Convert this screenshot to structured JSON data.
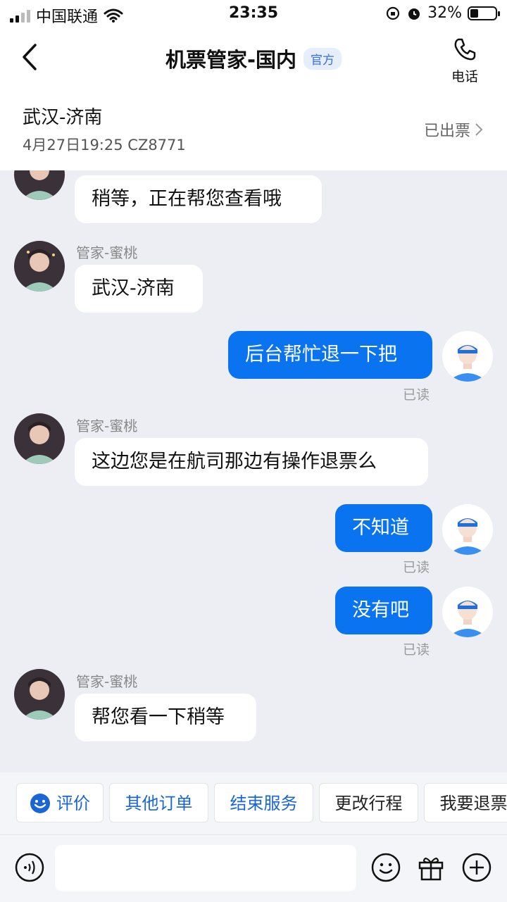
{
  "status_bar": {
    "carrier": "中国联通",
    "time": "23:35",
    "battery": "32%"
  },
  "header": {
    "title": "机票管家-国内",
    "badge": "官方",
    "phone_label": "电话"
  },
  "flight": {
    "route": "武汉-济南",
    "detail": "4月27日19:25 CZ8771",
    "status": "已出票"
  },
  "messages": [
    {
      "side": "in",
      "sender": "",
      "text": "稍等，正在帮您查看哦"
    },
    {
      "side": "in",
      "sender": "管家-蜜桃",
      "text": "武汉-济南"
    },
    {
      "side": "out",
      "text": "后台帮忙退一下把",
      "read": "已读"
    },
    {
      "side": "in",
      "sender": "管家-蜜桃",
      "text": "这边您是在航司那边有操作退票么"
    },
    {
      "side": "out",
      "text": "不知道",
      "read": "已读"
    },
    {
      "side": "out",
      "text": "没有吧",
      "read": "已读"
    },
    {
      "side": "in",
      "sender": "管家-蜜桃",
      "text": "帮您看一下稍等"
    }
  ],
  "quick_actions": [
    "评价",
    "其他订单",
    "结束服务",
    "更改行程",
    "我要退票"
  ],
  "colors": {
    "accent": "#0A73F0",
    "chat_bg": "#ECEEF3"
  }
}
